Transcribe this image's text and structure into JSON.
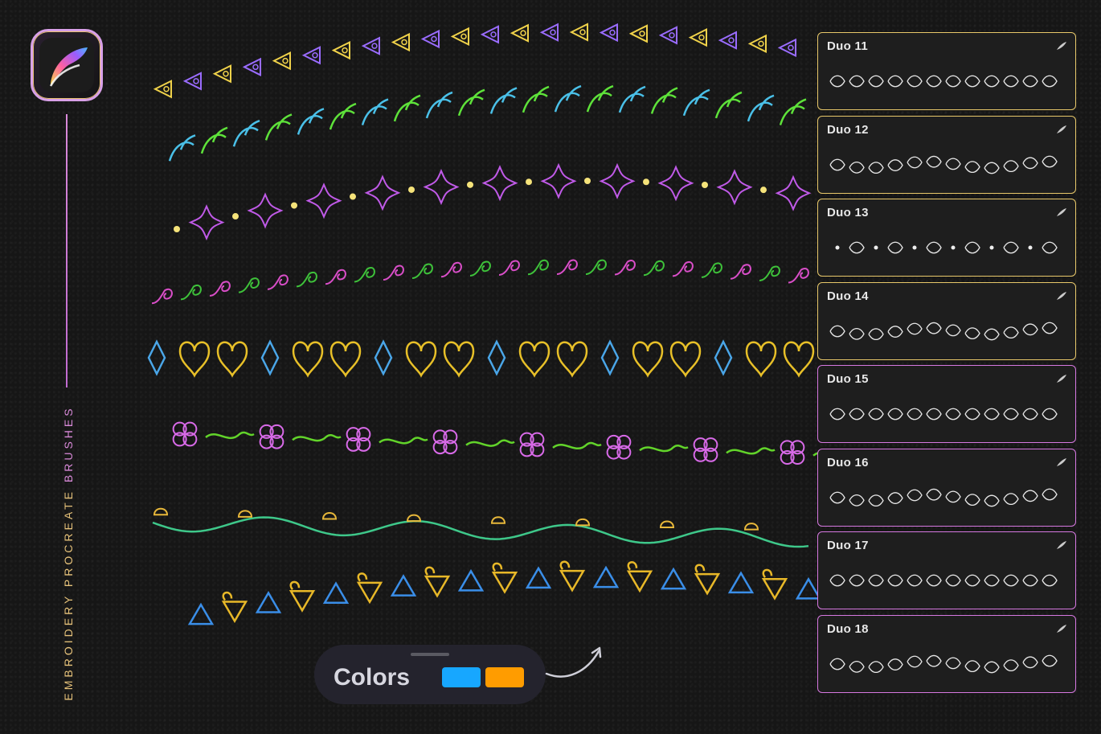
{
  "brand": {
    "vertical_title_main": "EMBROIDERY PROCREATE ",
    "vertical_title_accent": "BRUSHES",
    "app_icon": "procreate-logo-icon"
  },
  "brushes": [
    {
      "label": "Duo 11",
      "highlight": "gold"
    },
    {
      "label": "Duo 12",
      "highlight": "gold"
    },
    {
      "label": "Duo 13",
      "highlight": "gold"
    },
    {
      "label": "Duo 14",
      "highlight": "gold"
    },
    {
      "label": "Duo 15",
      "highlight": "pink"
    },
    {
      "label": "Duo 16",
      "highlight": "pink"
    },
    {
      "label": "Duo 17",
      "highlight": "pink"
    },
    {
      "label": "Duo 18",
      "highlight": "pink"
    }
  ],
  "colors_panel": {
    "title": "Colors",
    "swatch_primary": "#17a7ff",
    "swatch_secondary": "#ff9c00"
  },
  "theme": {
    "background": "#161616",
    "gold": "#e8c86a",
    "pink": "#d678e0"
  }
}
